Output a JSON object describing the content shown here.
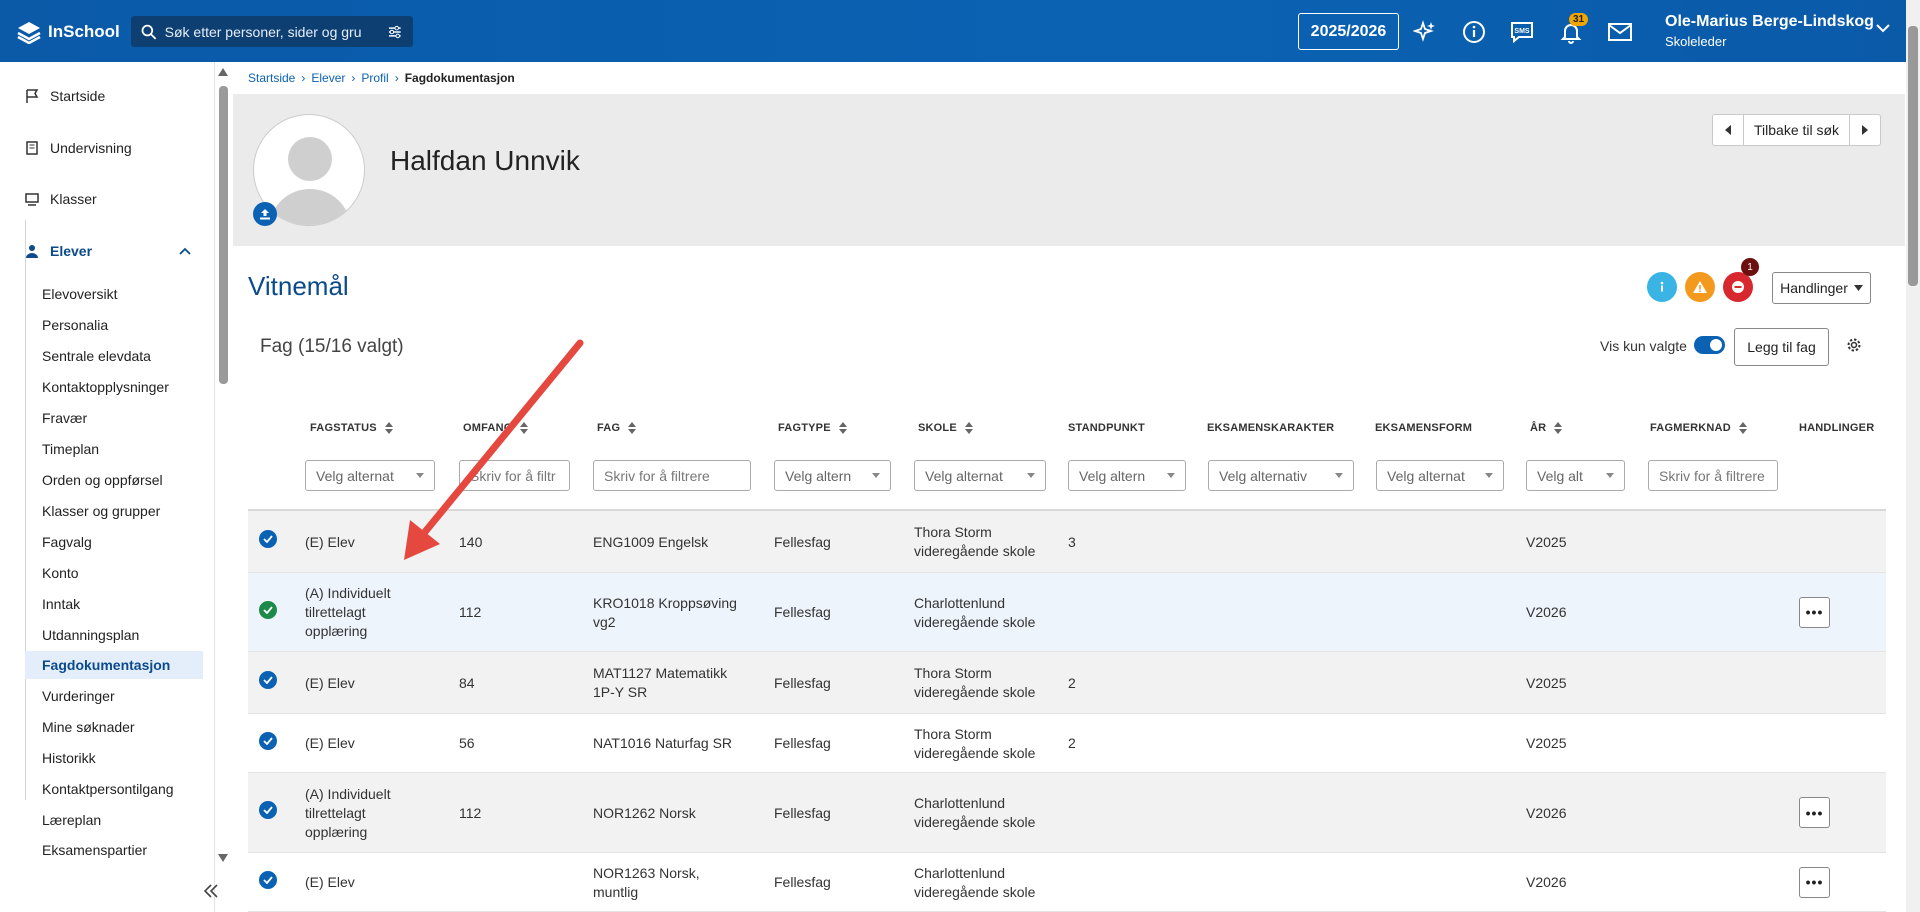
{
  "app": {
    "logo_text": "InSchool",
    "search_placeholder": "Søk etter personer, sider og gru",
    "year": "2025/2026",
    "notification_count": "31",
    "user_name": "Ole-Marius Berge-Lindskog",
    "user_role": "Skoleleder"
  },
  "sidebar": {
    "top_items": [
      {
        "label": "Startside",
        "icon": "flag-icon"
      },
      {
        "label": "Undervisning",
        "icon": "book-icon"
      },
      {
        "label": "Klasser",
        "icon": "classes-icon"
      },
      {
        "label": "Elever",
        "icon": "students-icon"
      }
    ],
    "sub_items": [
      "Elevoversikt",
      "Personalia",
      "Sentrale elevdata",
      "Kontaktopplysninger",
      "Fravær",
      "Timeplan",
      "Orden og oppførsel",
      "Klasser og grupper",
      "Fagvalg",
      "Konto",
      "Inntak",
      "Utdanningsplan",
      "Fagdokumentasjon",
      "Vurderinger",
      "Mine søknader",
      "Historikk",
      "Kontaktpersontilgang",
      "Læreplan",
      "Eksamenspartier"
    ],
    "active_sub": "Fagdokumentasjon"
  },
  "breadcrumb": [
    "Startside",
    "Elever",
    "Profil",
    "Fagdokumentasjon"
  ],
  "student": {
    "name": "Halfdan Unnvik"
  },
  "back_button": "Tilbake til søk",
  "section": {
    "title": "Vitnemål",
    "alert_count": "1",
    "actions_button": "Handlinger",
    "colors": {
      "info": "#3ab4e4",
      "warning": "#f39a1e",
      "error": "#d7282f"
    }
  },
  "fag": {
    "title": "Fag (15/16 valgt)",
    "toggle_label": "Vis kun valgte",
    "add_button": "Legg til fag"
  },
  "table": {
    "headers": [
      "FAGSTATUS",
      "OMFANG",
      "FAG",
      "FAGTYPE",
      "SKOLE",
      "STANDPUNKT",
      "EKSAMENSKARAKTER",
      "EKSAMENSFORM",
      "ÅR",
      "FAGMERKNAD",
      "HANDLINGER"
    ],
    "filters": [
      "Velg alternat",
      "Skriv for å filtr",
      "Skriv for å filtrere",
      "Velg altern",
      "Velg alternat",
      "Velg altern",
      "Velg alternativ",
      "Velg alternat",
      "Velg alt",
      "Skriv for å filtrere"
    ],
    "rows": [
      {
        "status": "(E) Elev",
        "omfang": "140",
        "fag": "ENG1009 Engelsk",
        "fagtype": "Fellesfag",
        "skole": "Thora Storm videregående skole",
        "standpunkt": "3",
        "aar": "V2025",
        "actions": false
      },
      {
        "status": "(A) Individuelt tilrettelagt opplæring",
        "omfang": "112",
        "fag": "KRO1018 Kroppsøving vg2",
        "fagtype": "Fellesfag",
        "skole": "Charlottenlund videregående skole",
        "standpunkt": "",
        "aar": "V2026",
        "actions": true
      },
      {
        "status": "(E) Elev",
        "omfang": "84",
        "fag": "MAT1127 Matematikk 1P-Y SR",
        "fagtype": "Fellesfag",
        "skole": "Thora Storm videregående skole",
        "standpunkt": "2",
        "aar": "V2025",
        "actions": false
      },
      {
        "status": "(E) Elev",
        "omfang": "56",
        "fag": "NAT1016 Naturfag SR",
        "fagtype": "Fellesfag",
        "skole": "Thora Storm videregående skole",
        "standpunkt": "2",
        "aar": "V2025",
        "actions": false
      },
      {
        "status": "(A) Individuelt tilrettelagt opplæring",
        "omfang": "112",
        "fag": "NOR1262 Norsk",
        "fagtype": "Fellesfag",
        "skole": "Charlottenlund videregående skole",
        "standpunkt": "",
        "aar": "V2026",
        "actions": true
      },
      {
        "status": "(E) Elev",
        "omfang": "",
        "fag": "NOR1263 Norsk, muntlig",
        "fagtype": "Fellesfag",
        "skole": "Charlottenlund videregående skole",
        "standpunkt": "",
        "aar": "V2026",
        "actions": true
      }
    ],
    "actions_label": "•••"
  }
}
